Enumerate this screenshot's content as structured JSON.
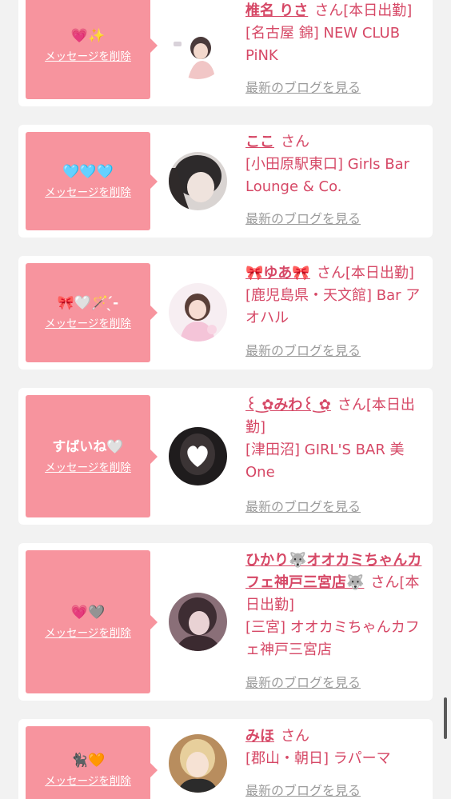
{
  "delete_label": "メッセージを削除",
  "blog_label": "最新のブログを見る",
  "san_label": "さん",
  "status_label": "[本日出勤]",
  "colors": {
    "accent": "#d64866",
    "bubble": "#f7949e",
    "link_gray": "#9b9b9b"
  },
  "entries": [
    {
      "message": "💗✨",
      "name": "椎名 りさ",
      "status": "[本日出勤]",
      "shop": "[名古屋 錦] NEW CLUB PiNK"
    },
    {
      "message": "🩵🩵🩵",
      "name": "ここ",
      "status": "",
      "shop": "[小田原駅東口] Girls Bar Lounge & Co."
    },
    {
      "message": "🎀🤍🪄 ̖́-",
      "name": "🎀ゆあ🎀",
      "status": "[本日出勤]",
      "shop": "[鹿児島県・天文館] Bar アオハル"
    },
    {
      "message": "すばいね🤍",
      "name": "꒰ ͜✿みわ꒰ ͜✿",
      "status": "[本日出勤]",
      "shop": "[津田沼] GIRL'S BAR 美One"
    },
    {
      "message": "💗🩶",
      "name": "ひかり🐺オオカミちゃんカフェ神戸三宮店🐺",
      "status": "[本日出勤]",
      "shop": "[三宮] オオカミちゃんカフェ神戸三宮店"
    },
    {
      "message": "🐈‍⬛🧡",
      "name": "みほ",
      "status": "",
      "shop": "[郡山・朝日] ラパーマ"
    }
  ]
}
